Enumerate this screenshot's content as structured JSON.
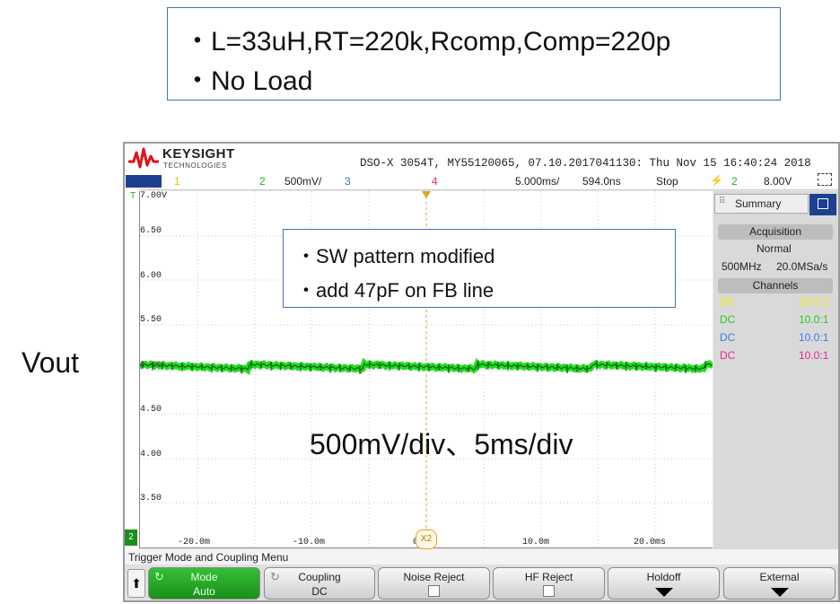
{
  "annotation_top": {
    "line1": "・L=33uH,RT=220k,Rcomp,Comp=220p",
    "line2": "・No Load"
  },
  "signal_label": "Vout",
  "scope": {
    "brand": "KEYSIGHT",
    "brand_sub": "TECHNOLOGIES",
    "device_info": "DSO-X 3054T, MY55120065, 07.10.2017041130: Thu Nov 15 16:40:24 2018",
    "ch1_num": "1",
    "ch2_num": "2",
    "ch2_scale": "500mV/",
    "ch3_num": "3",
    "ch4_num": "4",
    "timebase": "5.000ms/",
    "delay": "594.0ns",
    "run_state": "Stop",
    "trigger_channel": "2",
    "trigger_level": "8.00V",
    "y_labels": [
      "7.00V",
      "6.50",
      "6.00",
      "5.50",
      "5.00",
      "4.50",
      "4.00",
      "3.50"
    ],
    "x_labels": [
      "-20.0m",
      "-10.0m",
      "0",
      "10.0m",
      "20.0ms"
    ],
    "ground_marker": "2",
    "trigger_marker": "T",
    "cursor_label": "X2",
    "trace_color": "#22dd22",
    "side_panel": {
      "tab": "Summary",
      "acq_header": "Acquisition",
      "acq_mode": "Normal",
      "bandwidth": "500MHz",
      "sample_rate": "20.0MSa/s",
      "channels_header": "Channels",
      "channels": [
        {
          "coupling": "DC",
          "probe": "10.0:1",
          "color": "#f2f200"
        },
        {
          "coupling": "DC",
          "probe": "10.0:1",
          "color": "#22cc22"
        },
        {
          "coupling": "DC",
          "probe": "10.0:1",
          "color": "#3a7de0"
        },
        {
          "coupling": "DC",
          "probe": "10.0:1",
          "color": "#e8288c"
        }
      ]
    },
    "menu_title": "Trigger Mode and Coupling Menu",
    "softkeys": {
      "mode_label": "Mode",
      "mode_value": "Auto",
      "coupling_label": "Coupling",
      "coupling_value": "DC",
      "noise_reject_label": "Noise Reject",
      "hf_reject_label": "HF Reject",
      "holdoff_label": "Holdoff",
      "external_label": "External"
    }
  },
  "annotation_mod": {
    "line1": "・SW pattern modified",
    "line2": "・add 47pF on FB line"
  },
  "scale_note": "500mV/div、5ms/div"
}
